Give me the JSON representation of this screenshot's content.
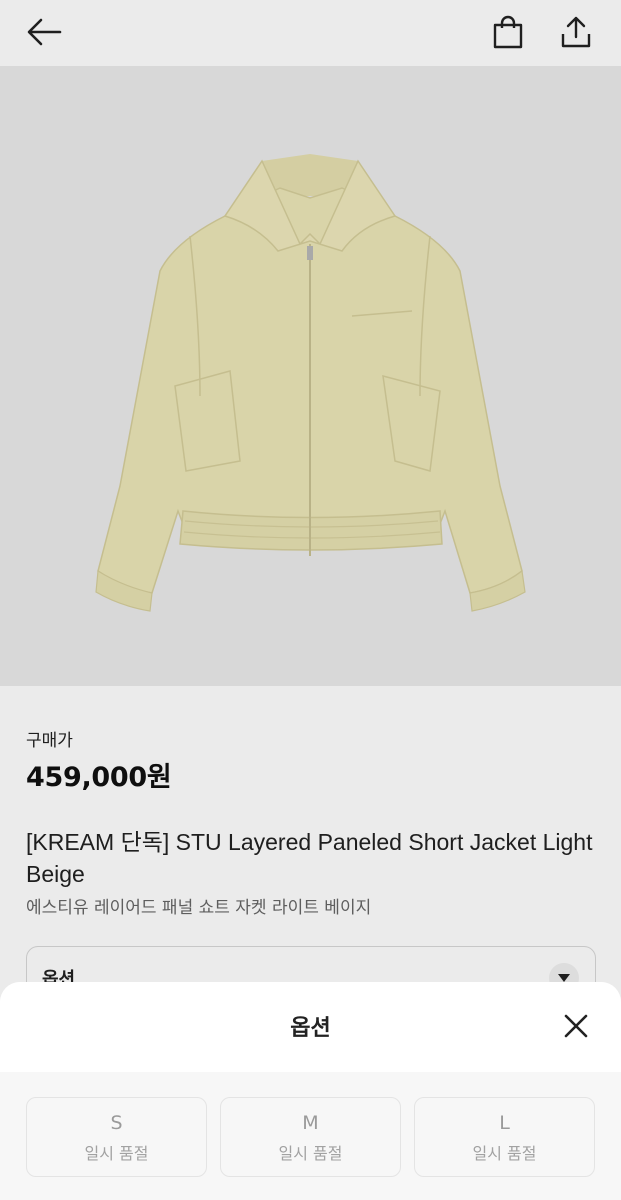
{
  "header": {
    "icons": [
      "back-arrow-icon",
      "shopping-bag-icon",
      "share-icon"
    ]
  },
  "product": {
    "price_label": "구매가",
    "price": "459,000원",
    "title": "[KREAM 단독] STU Layered Paneled Short Jacket Light Beige",
    "subtitle": "에스티유 레이어드 패널 쇼트 자켓 라이트 베이지",
    "image_bg": "#ebebeb",
    "jacket_color": "#ece6b8"
  },
  "option_box": {
    "label": "옵션"
  },
  "sheet": {
    "title": "옵션",
    "sizes": [
      {
        "size": "S",
        "status": "일시 품절"
      },
      {
        "size": "M",
        "status": "일시 품절"
      },
      {
        "size": "L",
        "status": "일시 품절"
      }
    ]
  }
}
